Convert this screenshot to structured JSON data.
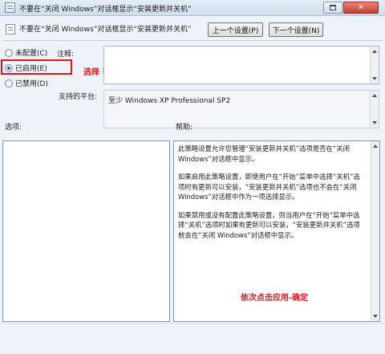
{
  "window": {
    "title": "不要在“关闭 Windows”对话框显示“安装更新并关机”",
    "maximize_label": "",
    "close_label": "✕"
  },
  "header": {
    "policy_title": "不要在“关闭 Windows”对话框显示“安装更新并关机”",
    "prev_button": "上一个设置(P)",
    "next_button": "下一个设置(N)"
  },
  "state": {
    "options": [
      {
        "label": "未配置(C)",
        "checked": false
      },
      {
        "label": "已启用(E)",
        "checked": true
      },
      {
        "label": "已禁用(D)",
        "checked": false
      }
    ],
    "annotation": "选择 已启用"
  },
  "fields": {
    "comment_label": "注释:",
    "comment_value": "",
    "platform_label": "支持的平台:",
    "platform_value": "至少 Windows XP Professional SP2"
  },
  "sections": {
    "options_label": "选项:",
    "help_label": "帮助:"
  },
  "help": {
    "paragraphs": [
      "此策略设置允许您管理“安装更新并关机”选项是否在“关闭 Windows”对话框中显示。",
      "如果启用此策略设置，即使用户在“开始”菜单中选择“关机”选项时有更新可以安装，“安装更新并关机”选项也不会在“关闭 Windows”对话框中作为一项选择显示。",
      "如果禁用或没有配置此策略设置，则当用户在“开始”菜单中选择“关机”选项时如果有更新可以安装，“安装更新并关机”选项就会在“关闭 Windows”对话框中显示。"
    ],
    "annotation": "依次点击应用-确定"
  },
  "colors": {
    "annotation": "#e0161f",
    "radio_selected": "#2d5ea8"
  },
  "icons": [
    "policy-icon",
    "maximize-icon",
    "close-icon",
    "scroll-up-icon",
    "scroll-down-icon"
  ]
}
